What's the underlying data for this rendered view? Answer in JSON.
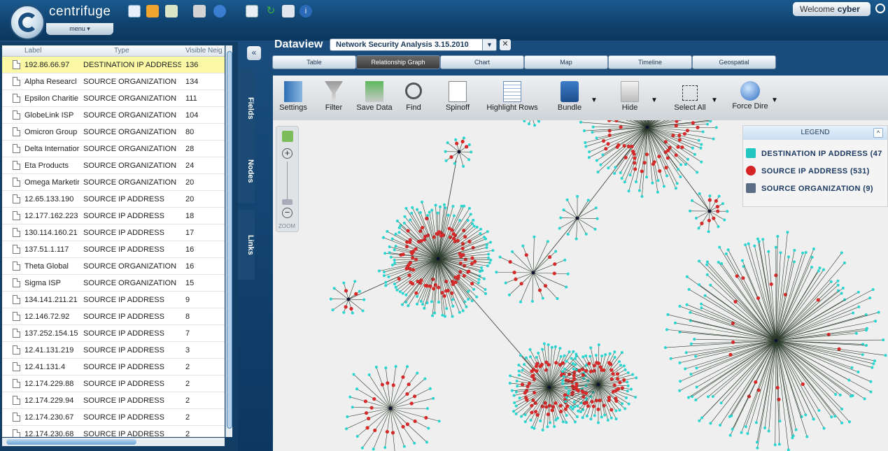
{
  "app": {
    "brand": "centrifuge",
    "menu_label": "menu ▾",
    "welcome_text": "Welcome",
    "username": "cyber"
  },
  "left_panel": {
    "columns": [
      "Label",
      "Type",
      "Visible Neig"
    ],
    "rows": [
      {
        "label": "192.86.66.97",
        "type": "DESTINATION IP ADDRESS",
        "visible": "136",
        "selected": true
      },
      {
        "label": "Alpha Researcl",
        "type": "SOURCE ORGANIZATION",
        "visible": "134"
      },
      {
        "label": "Epsilon Charitie",
        "type": "SOURCE ORGANIZATION",
        "visible": "111"
      },
      {
        "label": "GlobeLink ISP",
        "type": "SOURCE ORGANIZATION",
        "visible": "104"
      },
      {
        "label": "Omicron Group",
        "type": "SOURCE ORGANIZATION",
        "visible": "80"
      },
      {
        "label": "Delta Internatior",
        "type": "SOURCE ORGANIZATION",
        "visible": "28"
      },
      {
        "label": "Eta Products",
        "type": "SOURCE ORGANIZATION",
        "visible": "24"
      },
      {
        "label": "Omega Marketir",
        "type": "SOURCE ORGANIZATION",
        "visible": "20"
      },
      {
        "label": "12.65.133.190",
        "type": "SOURCE IP ADDRESS",
        "visible": "20"
      },
      {
        "label": "12.177.162.223",
        "type": "SOURCE IP ADDRESS",
        "visible": "18"
      },
      {
        "label": "130.114.160.21",
        "type": "SOURCE IP ADDRESS",
        "visible": "17"
      },
      {
        "label": "137.51.1.117",
        "type": "SOURCE IP ADDRESS",
        "visible": "16"
      },
      {
        "label": "Theta Global",
        "type": "SOURCE ORGANIZATION",
        "visible": "16"
      },
      {
        "label": "Sigma ISP",
        "type": "SOURCE ORGANIZATION",
        "visible": "15"
      },
      {
        "label": "134.141.211.21",
        "type": "SOURCE IP ADDRESS",
        "visible": "9"
      },
      {
        "label": "12.146.72.92",
        "type": "SOURCE IP ADDRESS",
        "visible": "8"
      },
      {
        "label": "137.252.154.15",
        "type": "SOURCE IP ADDRESS",
        "visible": "7"
      },
      {
        "label": "12.41.131.219",
        "type": "SOURCE IP ADDRESS",
        "visible": "3"
      },
      {
        "label": "12.41.131.4",
        "type": "SOURCE IP ADDRESS",
        "visible": "2"
      },
      {
        "label": "12.174.229.88",
        "type": "SOURCE IP ADDRESS",
        "visible": "2"
      },
      {
        "label": "12.174.229.94",
        "type": "SOURCE IP ADDRESS",
        "visible": "2"
      },
      {
        "label": "12.174.230.67",
        "type": "SOURCE IP ADDRESS",
        "visible": "2"
      },
      {
        "label": "12.174.230.68",
        "type": "SOURCE IP ADDRESS",
        "visible": "2"
      }
    ],
    "side_tabs": [
      "Fields",
      "Nodes",
      "Links"
    ],
    "collapse_label": "«"
  },
  "dataview": {
    "label": "Dataview",
    "selected": "Network Security Analysis 3.15.2010",
    "tabs": [
      "Table",
      "Relationship Graph",
      "Chart",
      "Map",
      "Timeline",
      "Geospatial"
    ],
    "active_tab": "Relationship Graph"
  },
  "toolbar": [
    "Settings",
    "Filter",
    "Save Data",
    "Find",
    "Spinoff",
    "Highlight Rows",
    "Bundle",
    "Hide",
    "Select All",
    "Force Dire"
  ],
  "zoom": {
    "label": "ZOOM"
  },
  "legend": {
    "title": "LEGEND",
    "items": [
      {
        "label": "DESTINATION IP ADDRESS (47",
        "color": "#22c6c0"
      },
      {
        "label": "SOURCE IP ADDRESS (531)",
        "color": "#d62323"
      },
      {
        "label": "SOURCE ORGANIZATION (9)",
        "color": "#5b6e86"
      }
    ]
  },
  "colors": {
    "node_cyan": "#2ad4cf",
    "node_red": "#d42a2a",
    "edge": "#2a3a2a",
    "accent": "#1b4f80"
  }
}
